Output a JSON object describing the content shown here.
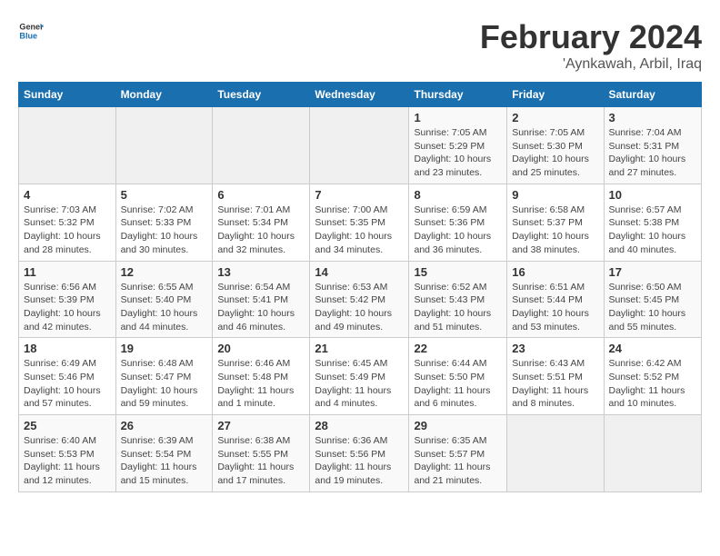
{
  "header": {
    "logo": {
      "general": "General",
      "blue": "Blue"
    },
    "title": "February 2024",
    "subtitle": "'Aynkawah, Arbil, Iraq"
  },
  "weekdays": [
    "Sunday",
    "Monday",
    "Tuesday",
    "Wednesday",
    "Thursday",
    "Friday",
    "Saturday"
  ],
  "weeks": [
    [
      {
        "day": "",
        "detail": ""
      },
      {
        "day": "",
        "detail": ""
      },
      {
        "day": "",
        "detail": ""
      },
      {
        "day": "",
        "detail": ""
      },
      {
        "day": "1",
        "detail": "Sunrise: 7:05 AM\nSunset: 5:29 PM\nDaylight: 10 hours\nand 23 minutes."
      },
      {
        "day": "2",
        "detail": "Sunrise: 7:05 AM\nSunset: 5:30 PM\nDaylight: 10 hours\nand 25 minutes."
      },
      {
        "day": "3",
        "detail": "Sunrise: 7:04 AM\nSunset: 5:31 PM\nDaylight: 10 hours\nand 27 minutes."
      }
    ],
    [
      {
        "day": "4",
        "detail": "Sunrise: 7:03 AM\nSunset: 5:32 PM\nDaylight: 10 hours\nand 28 minutes."
      },
      {
        "day": "5",
        "detail": "Sunrise: 7:02 AM\nSunset: 5:33 PM\nDaylight: 10 hours\nand 30 minutes."
      },
      {
        "day": "6",
        "detail": "Sunrise: 7:01 AM\nSunset: 5:34 PM\nDaylight: 10 hours\nand 32 minutes."
      },
      {
        "day": "7",
        "detail": "Sunrise: 7:00 AM\nSunset: 5:35 PM\nDaylight: 10 hours\nand 34 minutes."
      },
      {
        "day": "8",
        "detail": "Sunrise: 6:59 AM\nSunset: 5:36 PM\nDaylight: 10 hours\nand 36 minutes."
      },
      {
        "day": "9",
        "detail": "Sunrise: 6:58 AM\nSunset: 5:37 PM\nDaylight: 10 hours\nand 38 minutes."
      },
      {
        "day": "10",
        "detail": "Sunrise: 6:57 AM\nSunset: 5:38 PM\nDaylight: 10 hours\nand 40 minutes."
      }
    ],
    [
      {
        "day": "11",
        "detail": "Sunrise: 6:56 AM\nSunset: 5:39 PM\nDaylight: 10 hours\nand 42 minutes."
      },
      {
        "day": "12",
        "detail": "Sunrise: 6:55 AM\nSunset: 5:40 PM\nDaylight: 10 hours\nand 44 minutes."
      },
      {
        "day": "13",
        "detail": "Sunrise: 6:54 AM\nSunset: 5:41 PM\nDaylight: 10 hours\nand 46 minutes."
      },
      {
        "day": "14",
        "detail": "Sunrise: 6:53 AM\nSunset: 5:42 PM\nDaylight: 10 hours\nand 49 minutes."
      },
      {
        "day": "15",
        "detail": "Sunrise: 6:52 AM\nSunset: 5:43 PM\nDaylight: 10 hours\nand 51 minutes."
      },
      {
        "day": "16",
        "detail": "Sunrise: 6:51 AM\nSunset: 5:44 PM\nDaylight: 10 hours\nand 53 minutes."
      },
      {
        "day": "17",
        "detail": "Sunrise: 6:50 AM\nSunset: 5:45 PM\nDaylight: 10 hours\nand 55 minutes."
      }
    ],
    [
      {
        "day": "18",
        "detail": "Sunrise: 6:49 AM\nSunset: 5:46 PM\nDaylight: 10 hours\nand 57 minutes."
      },
      {
        "day": "19",
        "detail": "Sunrise: 6:48 AM\nSunset: 5:47 PM\nDaylight: 10 hours\nand 59 minutes."
      },
      {
        "day": "20",
        "detail": "Sunrise: 6:46 AM\nSunset: 5:48 PM\nDaylight: 11 hours\nand 1 minute."
      },
      {
        "day": "21",
        "detail": "Sunrise: 6:45 AM\nSunset: 5:49 PM\nDaylight: 11 hours\nand 4 minutes."
      },
      {
        "day": "22",
        "detail": "Sunrise: 6:44 AM\nSunset: 5:50 PM\nDaylight: 11 hours\nand 6 minutes."
      },
      {
        "day": "23",
        "detail": "Sunrise: 6:43 AM\nSunset: 5:51 PM\nDaylight: 11 hours\nand 8 minutes."
      },
      {
        "day": "24",
        "detail": "Sunrise: 6:42 AM\nSunset: 5:52 PM\nDaylight: 11 hours\nand 10 minutes."
      }
    ],
    [
      {
        "day": "25",
        "detail": "Sunrise: 6:40 AM\nSunset: 5:53 PM\nDaylight: 11 hours\nand 12 minutes."
      },
      {
        "day": "26",
        "detail": "Sunrise: 6:39 AM\nSunset: 5:54 PM\nDaylight: 11 hours\nand 15 minutes."
      },
      {
        "day": "27",
        "detail": "Sunrise: 6:38 AM\nSunset: 5:55 PM\nDaylight: 11 hours\nand 17 minutes."
      },
      {
        "day": "28",
        "detail": "Sunrise: 6:36 AM\nSunset: 5:56 PM\nDaylight: 11 hours\nand 19 minutes."
      },
      {
        "day": "29",
        "detail": "Sunrise: 6:35 AM\nSunset: 5:57 PM\nDaylight: 11 hours\nand 21 minutes."
      },
      {
        "day": "",
        "detail": ""
      },
      {
        "day": "",
        "detail": ""
      }
    ]
  ]
}
